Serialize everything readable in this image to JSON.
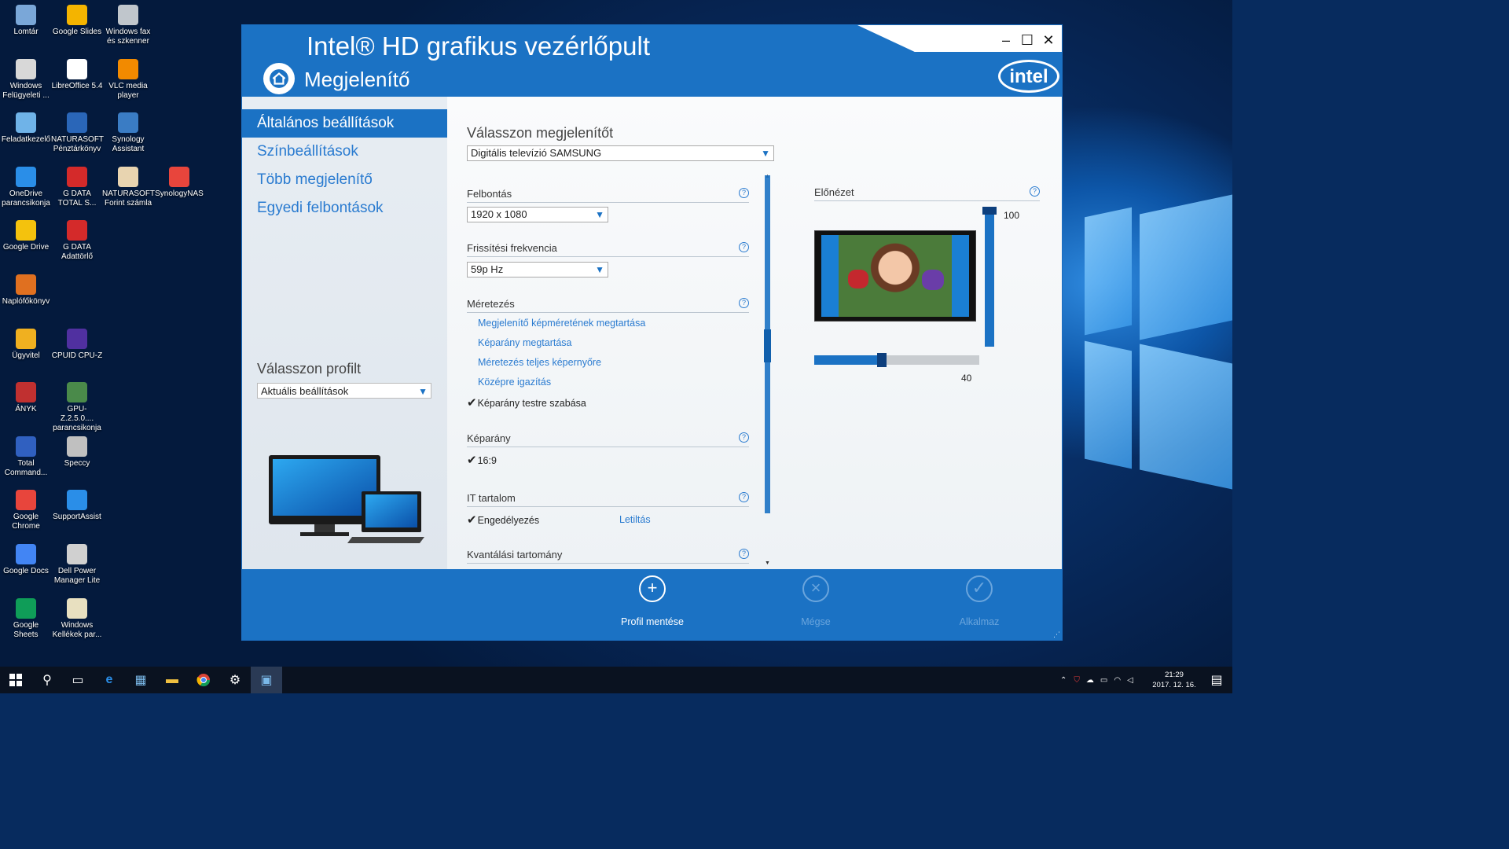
{
  "desktop": {
    "icons": [
      {
        "label": "Lomtár",
        "icon": "recycle-bin-icon",
        "color": "#7aa7d8"
      },
      {
        "label": "Google Slides",
        "icon": "google-slides-icon",
        "color": "#f4b400"
      },
      {
        "label": "Windows fax és szkenner",
        "icon": "fax-scanner-icon",
        "color": "#c0c6cc"
      },
      {
        "label": "Windows Felügyeleti ...",
        "icon": "admin-tools-icon",
        "color": "#d8d8d8"
      },
      {
        "label": "LibreOffice 5.4",
        "icon": "libreoffice-icon",
        "color": "#ffffff"
      },
      {
        "label": "VLC media player",
        "icon": "vlc-icon",
        "color": "#f28a00"
      },
      {
        "label": "Feladatkezelő",
        "icon": "task-manager-icon",
        "color": "#6fb3e8"
      },
      {
        "label": "NATURASOFT Pénztárkönyv",
        "icon": "naturasoft-icon",
        "color": "#2a66b8"
      },
      {
        "label": "Synology Assistant",
        "icon": "synology-icon",
        "color": "#3a7cc4"
      },
      {
        "label": "OneDrive parancsikonja",
        "icon": "onedrive-icon",
        "color": "#2a8ee8"
      },
      {
        "label": "G DATA TOTAL S...",
        "icon": "gdata-shield-icon",
        "color": "#d42a2a"
      },
      {
        "label": "NATURASOFT Forint számla",
        "icon": "naturasoft-invoice-icon",
        "color": "#e8d4b0"
      },
      {
        "label": "SynologyNAS",
        "icon": "chrome-icon",
        "color": "#e8453c"
      },
      {
        "label": "Google Drive",
        "icon": "google-drive-icon",
        "color": "#f4c20d"
      },
      {
        "label": "G DATA Adattörlő",
        "icon": "gdata-shredder-icon",
        "color": "#d42a2a"
      },
      {
        "label": "Naplófőkönyv",
        "icon": "fox-icon",
        "color": "#e07020"
      },
      {
        "label": "Ügyvitel",
        "icon": "ugyvitel-icon",
        "color": "#f0b020"
      },
      {
        "label": "CPUID CPU-Z",
        "icon": "cpuz-icon",
        "color": "#5030a0"
      },
      {
        "label": "ÁNYK",
        "icon": "anyk-icon",
        "color": "#c03030"
      },
      {
        "label": "GPU-Z.2.5.0.... parancsikonja",
        "icon": "gpuz-icon",
        "color": "#4a8a4a"
      },
      {
        "label": "Total Command...",
        "icon": "total-commander-icon",
        "color": "#3060c0"
      },
      {
        "label": "Speccy",
        "icon": "speccy-icon",
        "color": "#c0c0c0"
      },
      {
        "label": "Google Chrome",
        "icon": "chrome-icon",
        "color": "#e8453c"
      },
      {
        "label": "SupportAssist",
        "icon": "supportassist-icon",
        "color": "#2a8ee8"
      },
      {
        "label": "Google Docs",
        "icon": "google-docs-icon",
        "color": "#4285f4"
      },
      {
        "label": "Dell Power Manager Lite",
        "icon": "dell-power-icon",
        "color": "#d0d0d0"
      },
      {
        "label": "Google Sheets",
        "icon": "google-sheets-icon",
        "color": "#0f9d58"
      },
      {
        "label": "Windows Kellékek par...",
        "icon": "windows-accessories-icon",
        "color": "#e8e0c0"
      }
    ]
  },
  "window": {
    "app_title": "Intel® HD grafikus vezérlőpult",
    "page_title": "Megjelenítő",
    "minimize": "–",
    "maximize": "☐",
    "close": "✕",
    "logo": "intel"
  },
  "sidebar": {
    "items": [
      {
        "label": "Általános beállítások",
        "active": true
      },
      {
        "label": "Színbeállítások",
        "active": false
      },
      {
        "label": "Több megjelenítő",
        "active": false
      },
      {
        "label": "Egyedi felbontások",
        "active": false
      }
    ],
    "profile_label": "Válasszon profilt",
    "profile_value": "Aktuális beállítások"
  },
  "main": {
    "display_label": "Válasszon megjelenítőt",
    "display_value": "Digitális televízió SAMSUNG",
    "resolution_label": "Felbontás",
    "resolution_value": "1920 x 1080",
    "refresh_label": "Frissítési frekvencia",
    "refresh_value": "59p Hz",
    "scaling_label": "Méretezés",
    "scaling_options": [
      "Megjelenítő képméretének megtartása",
      "Képarány megtartása",
      "Méretezés teljes képernyőre",
      "Középre igazítás"
    ],
    "scaling_selected": "Képarány testre szabása",
    "aspect_label": "Képarány",
    "aspect_value": "16:9",
    "it_label": "IT tartalom",
    "it_enabled": "Engedélyezés",
    "it_disable": "Letiltás",
    "quant_label": "Kvantálási tartomány",
    "help": "?",
    "check_mark": "✔",
    "preview_label": "Előnézet",
    "vertical_value": "100",
    "horizontal_value": "40"
  },
  "bottom": {
    "save": "Profil mentése",
    "cancel": "Mégse",
    "apply": "Alkalmaz"
  },
  "taskbar": {
    "time": "21:29",
    "date": "2017. 12. 16."
  }
}
